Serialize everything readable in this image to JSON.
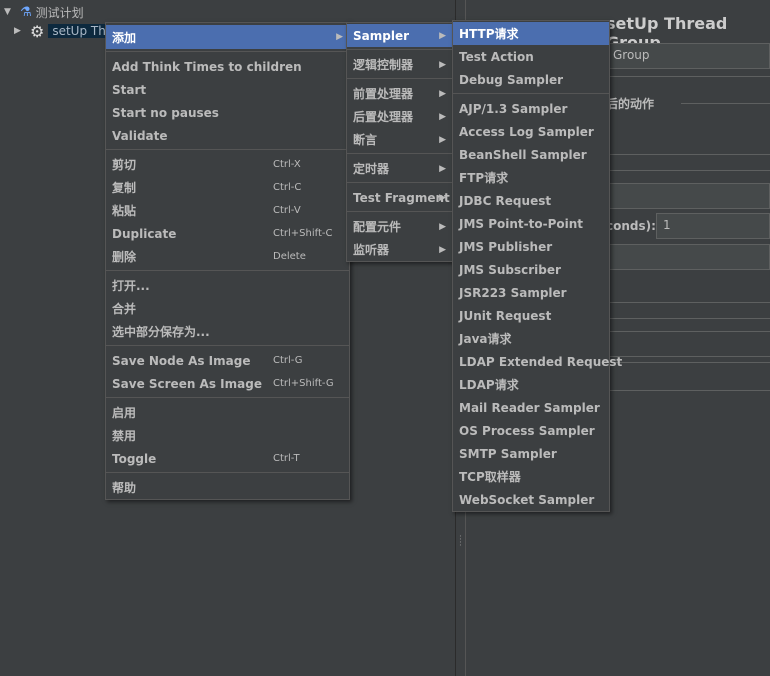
{
  "tree": {
    "root": "测试计划",
    "child": "setUp Thread Group",
    "child_visible": "setUp Thre"
  },
  "right_panel": {
    "title": "setUp Thread Group",
    "name_value": "Group",
    "section": "后的动作",
    "ramp_label": "conds):",
    "ramp_value": "1"
  },
  "menu_main": {
    "items": [
      {
        "label": "添加",
        "submenu": true,
        "highlighted": true
      },
      {
        "sep": true
      },
      {
        "label": "Add Think Times to children"
      },
      {
        "label": "Start"
      },
      {
        "label": "Start no pauses"
      },
      {
        "label": "Validate"
      },
      {
        "sep": true
      },
      {
        "label": "剪切",
        "shortcut": "Ctrl-X"
      },
      {
        "label": "复制",
        "shortcut": "Ctrl-C"
      },
      {
        "label": "粘贴",
        "shortcut": "Ctrl-V"
      },
      {
        "label": "Duplicate",
        "shortcut": "Ctrl+Shift-C"
      },
      {
        "label": "删除",
        "shortcut": "Delete"
      },
      {
        "sep": true
      },
      {
        "label": "打开..."
      },
      {
        "label": "合并"
      },
      {
        "label": "选中部分保存为..."
      },
      {
        "sep": true
      },
      {
        "label": "Save Node As Image",
        "shortcut": "Ctrl-G"
      },
      {
        "label": "Save Screen As Image",
        "shortcut": "Ctrl+Shift-G"
      },
      {
        "sep": true
      },
      {
        "label": "启用"
      },
      {
        "label": "禁用"
      },
      {
        "label": "Toggle",
        "shortcut": "Ctrl-T"
      },
      {
        "sep": true
      },
      {
        "label": "帮助"
      }
    ]
  },
  "menu_add": {
    "items": [
      {
        "label": "Sampler",
        "submenu": true,
        "highlighted": true
      },
      {
        "sep": true
      },
      {
        "label": "逻辑控制器",
        "submenu": true
      },
      {
        "sep": true
      },
      {
        "label": "前置处理器",
        "submenu": true
      },
      {
        "label": "后置处理器",
        "submenu": true
      },
      {
        "label": "断言",
        "submenu": true
      },
      {
        "sep": true
      },
      {
        "label": "定时器",
        "submenu": true
      },
      {
        "sep": true
      },
      {
        "label": "Test Fragment",
        "submenu": true
      },
      {
        "sep": true
      },
      {
        "label": "配置元件",
        "submenu": true
      },
      {
        "label": "监听器",
        "submenu": true
      }
    ]
  },
  "menu_sampler": {
    "items": [
      {
        "label": "HTTP请求",
        "highlighted": true
      },
      {
        "label": "Test Action"
      },
      {
        "label": "Debug Sampler"
      },
      {
        "sep": true
      },
      {
        "label": "AJP/1.3 Sampler"
      },
      {
        "label": "Access Log Sampler"
      },
      {
        "label": "BeanShell Sampler"
      },
      {
        "label": "FTP请求"
      },
      {
        "label": "JDBC Request"
      },
      {
        "label": "JMS Point-to-Point"
      },
      {
        "label": "JMS Publisher"
      },
      {
        "label": "JMS Subscriber"
      },
      {
        "label": "JSR223 Sampler"
      },
      {
        "label": "JUnit Request"
      },
      {
        "label": "Java请求"
      },
      {
        "label": "LDAP Extended Request"
      },
      {
        "label": "LDAP请求"
      },
      {
        "label": "Mail Reader Sampler"
      },
      {
        "label": "OS Process Sampler"
      },
      {
        "label": "SMTP Sampler"
      },
      {
        "label": "TCP取样器"
      },
      {
        "label": "WebSocket Sampler"
      }
    ]
  },
  "icons": {
    "arrow": "submenu-arrow-icon",
    "root": "flask-icon",
    "child": "gear-icon"
  },
  "colors": {
    "highlight": "#4b6eaf",
    "background": "#3c3f41"
  }
}
